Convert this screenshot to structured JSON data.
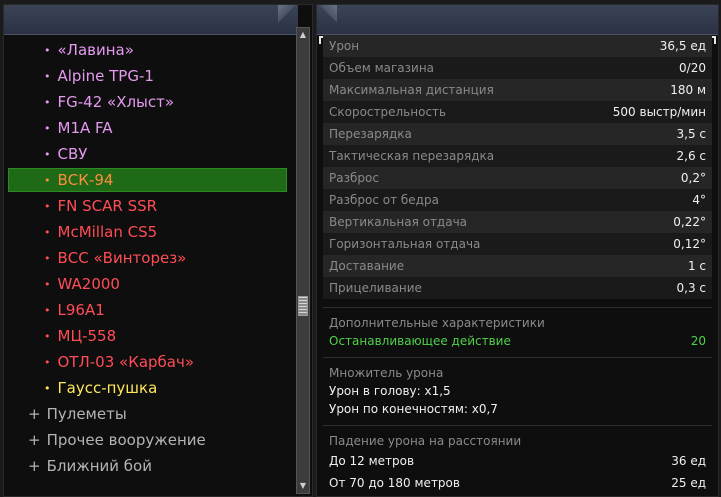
{
  "weapons": [
    {
      "label": "«Лавина»",
      "color": "pink"
    },
    {
      "label": "Alpine TPG-1",
      "color": "pink"
    },
    {
      "label": "FG-42 «Хлыст»",
      "color": "pink"
    },
    {
      "label": "M1A FA",
      "color": "pink"
    },
    {
      "label": "СВУ",
      "color": "pink"
    },
    {
      "label": "ВСК-94",
      "color": "orange",
      "selected": true
    },
    {
      "label": "FN SCAR SSR",
      "color": "red"
    },
    {
      "label": "McMillan CS5",
      "color": "red"
    },
    {
      "label": "ВСС «Винторез»",
      "color": "red"
    },
    {
      "label": "WA2000",
      "color": "red"
    },
    {
      "label": "L96A1",
      "color": "red"
    },
    {
      "label": "МЦ-558",
      "color": "red"
    },
    {
      "label": "ОТЛ-03 «Карбач»",
      "color": "red"
    },
    {
      "label": "Гаусс-пушка",
      "color": "yellow"
    }
  ],
  "categories": [
    {
      "icon": "+",
      "label": "Пулеметы"
    },
    {
      "icon": "+",
      "label": "Прочее вооружение"
    },
    {
      "icon": "+",
      "label": "Ближний бой"
    }
  ],
  "stats": [
    {
      "label": "Урон",
      "value": "36,5 ед"
    },
    {
      "label": "Объем магазина",
      "value": "0/20"
    },
    {
      "label": "Максимальная дистанция",
      "value": "180 м"
    },
    {
      "label": "Скорострельность",
      "value": "500 выстр/мин"
    },
    {
      "label": "Перезарядка",
      "value": "3,5 с"
    },
    {
      "label": "Тактическая перезарядка",
      "value": "2,6 с"
    },
    {
      "label": "Разброс",
      "value": "0,2°"
    },
    {
      "label": "Разброс от бедра",
      "value": "4°"
    },
    {
      "label": "Вертикальная отдача",
      "value": "0,22°"
    },
    {
      "label": "Горизонтальная отдача",
      "value": "0,12°"
    },
    {
      "label": "Доставание",
      "value": "1 с"
    },
    {
      "label": "Прицеливание",
      "value": "0,3 с"
    }
  ],
  "extra": {
    "title": "Дополнительные характеристики",
    "stopping_label": "Останавливающее действие",
    "stopping_value": "20"
  },
  "multiplier": {
    "title": "Множитель урона",
    "head": "Урон в голову: x1,5",
    "limbs": "Урон по конечностям: x0,7"
  },
  "falloff": {
    "title": "Падение урона на расстоянии",
    "rows": [
      {
        "label": "До 12 метров",
        "value": "36 ед"
      },
      {
        "label": "От 70 до 180 метров",
        "value": "25 ед"
      }
    ]
  },
  "icons": {
    "bullet": "•",
    "scroll_up": "▲",
    "scroll_down": "▼"
  },
  "colors": {
    "pink": "#e59af0",
    "red": "#ff4d55",
    "orange": "#ff8b3d",
    "yellow": "#ffe85a",
    "selected_bg": "#1e6a16",
    "stopping_green": "#4fd14a"
  }
}
